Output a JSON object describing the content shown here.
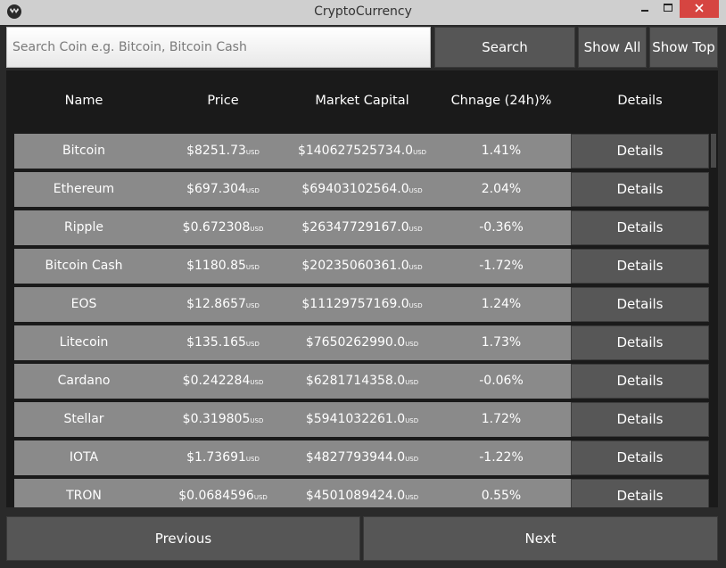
{
  "window": {
    "title": "CryptoCurrency"
  },
  "search": {
    "placeholder": "Search Coin e.g. Bitcoin, Bitcoin Cash",
    "value": ""
  },
  "toolbar": {
    "search_label": "Search",
    "show_all_label": "Show All",
    "show_top_label": "Show Top"
  },
  "table": {
    "headers": [
      "Name",
      "Price",
      "Market Capital",
      "Chnage (24h)%",
      "Details"
    ],
    "unit": "USD",
    "rows": [
      {
        "name": "Bitcoin",
        "price": "$8251.73",
        "cap": "$140627525734.0",
        "change": "1.41%",
        "details": "Details"
      },
      {
        "name": "Ethereum",
        "price": "$697.304",
        "cap": "$69403102564.0",
        "change": "2.04%",
        "details": "Details"
      },
      {
        "name": "Ripple",
        "price": "$0.672308",
        "cap": "$26347729167.0",
        "change": "-0.36%",
        "details": "Details"
      },
      {
        "name": "Bitcoin Cash",
        "price": "$1180.85",
        "cap": "$20235060361.0",
        "change": "-1.72%",
        "details": "Details"
      },
      {
        "name": "EOS",
        "price": "$12.8657",
        "cap": "$11129757169.0",
        "change": "1.24%",
        "details": "Details"
      },
      {
        "name": "Litecoin",
        "price": "$135.165",
        "cap": "$7650262990.0",
        "change": "1.73%",
        "details": "Details"
      },
      {
        "name": "Cardano",
        "price": "$0.242284",
        "cap": "$6281714358.0",
        "change": "-0.06%",
        "details": "Details"
      },
      {
        "name": "Stellar",
        "price": "$0.319805",
        "cap": "$5941032261.0",
        "change": "1.72%",
        "details": "Details"
      },
      {
        "name": "IOTA",
        "price": "$1.73691",
        "cap": "$4827793944.0",
        "change": "-1.22%",
        "details": "Details"
      },
      {
        "name": "TRON",
        "price": "$0.0684596",
        "cap": "$4501089424.0",
        "change": "0.55%",
        "details": "Details"
      }
    ]
  },
  "pagination": {
    "previous_label": "Previous",
    "next_label": "Next"
  }
}
